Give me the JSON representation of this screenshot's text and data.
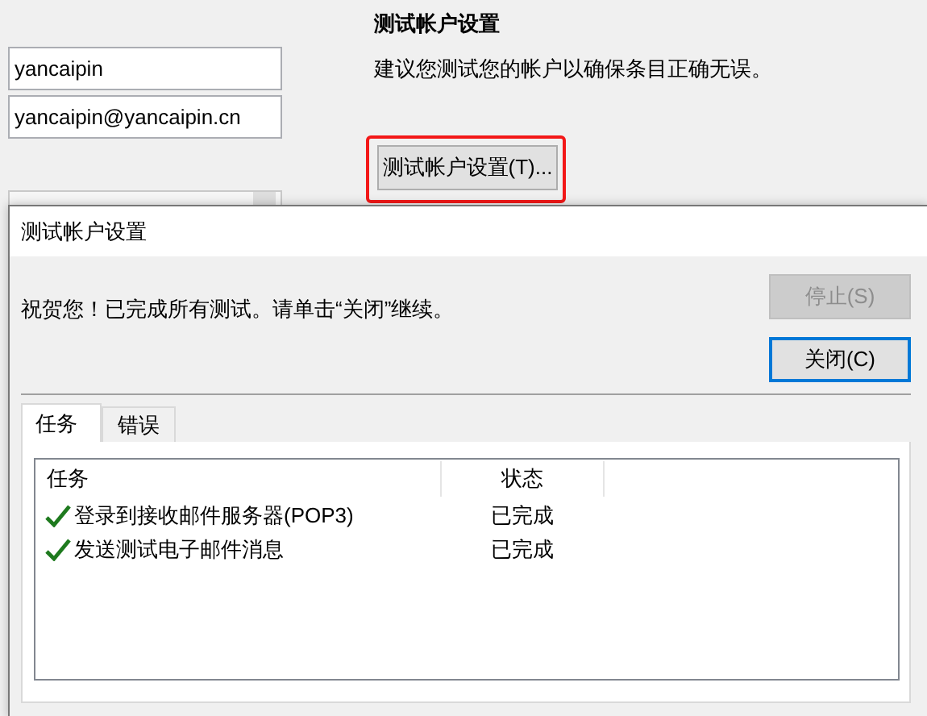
{
  "background": {
    "fields": [
      {
        "value": "yancaipin"
      },
      {
        "value": "yancaipin@yancaipin.cn"
      }
    ],
    "section": {
      "title": "测试帐户设置",
      "description": "建议您测试您的帐户以确保条目正确无误。"
    },
    "test_button": {
      "label": "测试帐户设置(T)...",
      "highlighted": true
    }
  },
  "dialog": {
    "title": "测试帐户设置",
    "message": "祝贺您！已完成所有测试。请单击“关闭”继续。",
    "buttons": [
      {
        "label": "停止(S)",
        "disabled": true,
        "focused": false
      },
      {
        "label": "关闭(C)",
        "disabled": false,
        "focused": true
      }
    ],
    "tabs": [
      {
        "label": "任务",
        "selected": true
      },
      {
        "label": "错误",
        "selected": false
      }
    ],
    "table": {
      "columns": [
        "任务",
        "状态"
      ],
      "rows": [
        {
          "task": "登录到接收邮件服务器(POP3)",
          "status": "已完成",
          "done": true
        },
        {
          "task": "发送测试电子邮件消息",
          "status": "已完成",
          "done": true
        }
      ]
    }
  }
}
